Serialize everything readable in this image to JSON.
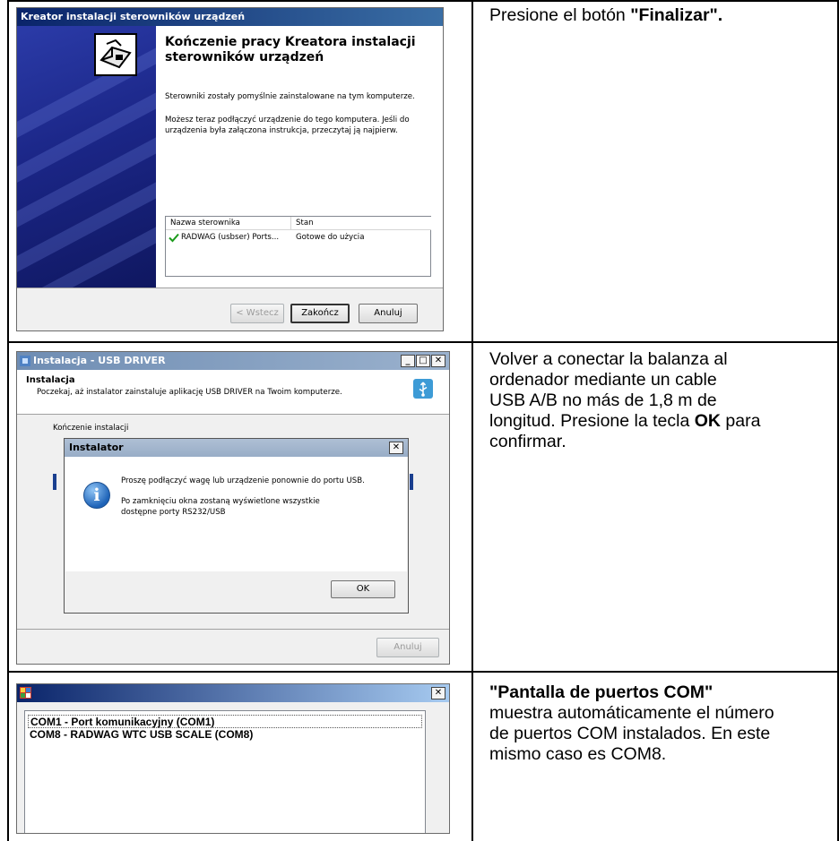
{
  "colors": {
    "wizard_titlebar": "#0a246a",
    "installer_titlebar": "#7a96b8",
    "com_titlebar": "#0a246a",
    "checkmark": "#1a9a1a"
  },
  "row1": {
    "window_title": "Kreator instalacji sterowników urządzeń",
    "heading": "Kończenie pracy Kreatora instalacji sterowników urządzeń",
    "para1": "Sterowniki zostały pomyślnie zainstalowane na tym komputerze.",
    "para2": "Możesz teraz podłączyć urządzenie do tego komputera. Jeśli do urządzenia była załączona instrukcja, przeczytaj ją najpierw.",
    "list_headers": [
      "Nazwa sterownika",
      "Stan"
    ],
    "list_row": {
      "name": "RADWAG (usbser) Ports...",
      "status": "Gotowe do użycia"
    },
    "btn_back": "< Wstecz",
    "btn_finish": "Zakończ",
    "btn_cancel": "Anuluj",
    "description_pre": "Presione el botón ",
    "description_bold": "\"Finalizar\"."
  },
  "row2": {
    "window_title": "Instalacja - USB DRIVER",
    "header_title": "Instalacja",
    "header_sub": "Poczekaj, aż instalator zainstaluje aplikację USB DRIVER na Twoim komputerze.",
    "behind_text": "Kończenie instalacji",
    "dialog_title": "Instalator",
    "dialog_msg1": "Proszę podłączyć wagę lub urządzenie ponownie do portu USB.",
    "dialog_msg2": "Po zamknięciu okna zostaną wyświetlone wszystkie dostępne porty RS232/USB",
    "btn_ok": "OK",
    "btn_cancel": "Anuluj",
    "description_line1": "Volver a conectar la balanza al",
    "description_line2": "ordenador mediante un cable",
    "description_line3": "USB A/B no más de 1,8 m de",
    "description_line4_pre": "longitud. Presione la tecla ",
    "description_line4_bold": "OK",
    "description_line4_post": " para",
    "description_line5": "confirmar."
  },
  "row3": {
    "ports": [
      "COM1 - Port komunikacyjny (COM1)",
      "COM8 - RADWAG WTC USB SCALE (COM8)"
    ],
    "description_bold": "\"Pantalla de puertos COM\"",
    "description_line2": "muestra automáticamente el número",
    "description_line3": "de puertos COM instalados. En este",
    "description_line4": "mismo caso es COM8."
  },
  "icons": [
    "close-icon",
    "minimize-icon",
    "maximize-icon",
    "wizard-hardware-icon",
    "usb-icon",
    "info-icon",
    "checkmark-icon",
    "app-icon"
  ]
}
